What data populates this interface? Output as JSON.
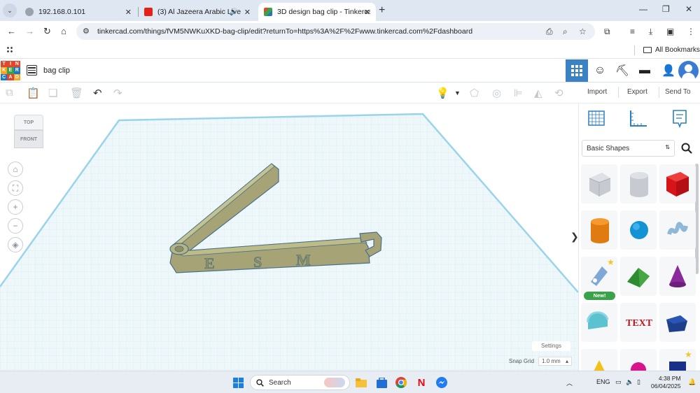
{
  "browser": {
    "tabs": [
      {
        "title": "192.168.0.101",
        "active": false
      },
      {
        "title": "(3) Al Jazeera Arabic Live",
        "active": false
      },
      {
        "title": "3D design bag clip - Tinkercad",
        "active": true
      }
    ],
    "url": "tinkercad.com/things/fVM5NWKuXKD-bag-clip/edit?returnTo=https%3A%2F%2Fwww.tinkercad.com%2Fdashboard",
    "bookmarks_label": "All Bookmarks"
  },
  "tinkercad": {
    "logo_letters": [
      "T",
      "I",
      "N",
      "K",
      "E",
      "R",
      "C",
      "A",
      "D"
    ],
    "logo_colors": [
      "#e2462b",
      "#e2462b",
      "#e2462b",
      "#f5a623",
      "#3aa34a",
      "#1f76c2",
      "#1f76c2",
      "#e2462b",
      "#f5a623"
    ],
    "project_title": "bag clip",
    "side_actions": {
      "import": "Import",
      "export": "Export",
      "send_to": "Send To"
    },
    "viewcube": {
      "top": "TOP",
      "front": "FRONT"
    },
    "settings_label": "Settings",
    "snap_grid_label": "Snap Grid",
    "snap_grid_value": "1.0 mm",
    "shape_category": "Basic Shapes",
    "new_badge": "New!",
    "model_letters": [
      "E",
      "S",
      "M"
    ]
  },
  "taskbar": {
    "search_placeholder": "Search",
    "language": "ENG",
    "time": "4:38 PM",
    "date": "06/04/2025"
  },
  "colors": {
    "accent": "#3b82c4",
    "workplane_grid": "#cfe6ef",
    "model": "#a6a476"
  }
}
